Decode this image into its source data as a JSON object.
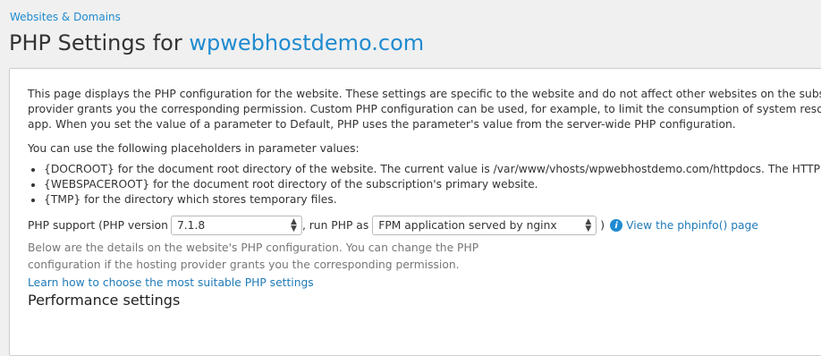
{
  "breadcrumb": "Websites & Domains",
  "title": {
    "prefix": "PHP Settings for",
    "domain": "wpwebhostdemo.com"
  },
  "intro": [
    "This page displays the PHP configuration for the website. These settings are specific to the website and do not affect other websites on the subscrip",
    "provider grants you the corresponding permission. Custom PHP configuration can be used, for example, to limit the consumption of system resour",
    "app. When you set the value of a parameter to Default, PHP uses the parameter's value from the server-wide PHP configuration."
  ],
  "placeholders_intro": "You can use the following placeholders in parameter values:",
  "placeholders": [
    "{DOCROOT} for the document root directory of the website. The current value is /var/www/vhosts/wpwebhostdemo.com/httpdocs. The HTTPS d",
    "{WEBSPACEROOT} for the document root directory of the subscription's primary website.",
    "{TMP} for the directory which stores temporary files."
  ],
  "php_row": {
    "label_before": "PHP support (PHP version",
    "version_value": "7.1.8",
    "label_middle": ", run PHP as",
    "handler_value": "FPM application served by nginx",
    "label_after": ")",
    "info_icon": "info-icon",
    "phpinfo_link": "View the phpinfo() page"
  },
  "details": [
    "Below are the details on the website's PHP configuration. You can change the PHP",
    "configuration if the hosting provider grants you the corresponding permission."
  ],
  "learn_link": "Learn how to choose the most suitable PHP settings",
  "section_title": "Performance settings",
  "colors": {
    "accent": "#1f8bd0",
    "background": "#f0f0f0",
    "panel": "#ffffff"
  }
}
